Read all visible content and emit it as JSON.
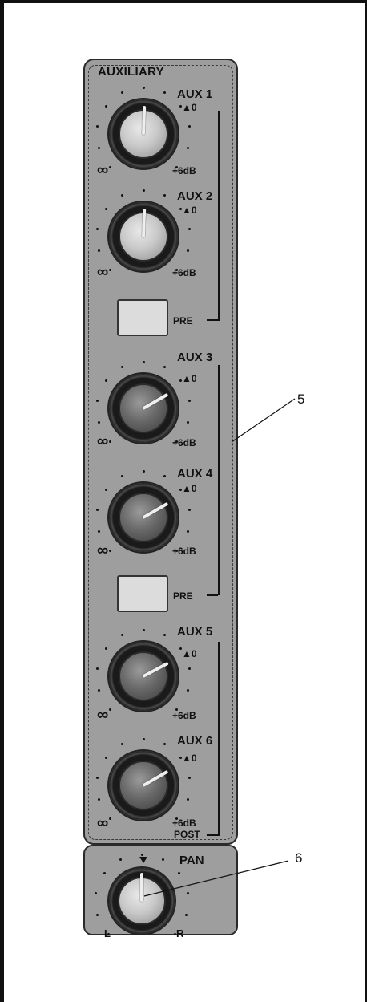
{
  "auxiliary": {
    "title": "AUXILIARY",
    "channels": [
      {
        "label": "AUX 1",
        "zero_mark": "▲0",
        "max_label": "+6dB",
        "min_symbol": "∞"
      },
      {
        "label": "AUX 2",
        "zero_mark": "▲0",
        "max_label": "+6dB",
        "min_symbol": "∞"
      },
      {
        "label": "AUX 3",
        "zero_mark": "▲0",
        "max_label": "+6dB",
        "min_symbol": "∞"
      },
      {
        "label": "AUX 4",
        "zero_mark": "▲0",
        "max_label": "+6dB",
        "min_symbol": "∞"
      },
      {
        "label": "AUX 5",
        "zero_mark": "▲0",
        "max_label": "+6dB",
        "min_symbol": "∞"
      },
      {
        "label": "AUX 6",
        "zero_mark": "▲0",
        "max_label": "+6dB",
        "min_symbol": "∞"
      }
    ],
    "pre_buttons": [
      {
        "label": "PRE"
      },
      {
        "label": "PRE"
      }
    ],
    "post_label": "POST"
  },
  "pan": {
    "title": "PAN",
    "left_label": "L",
    "right_label": "R"
  },
  "callouts": [
    {
      "number": "5"
    },
    {
      "number": "6"
    }
  ]
}
